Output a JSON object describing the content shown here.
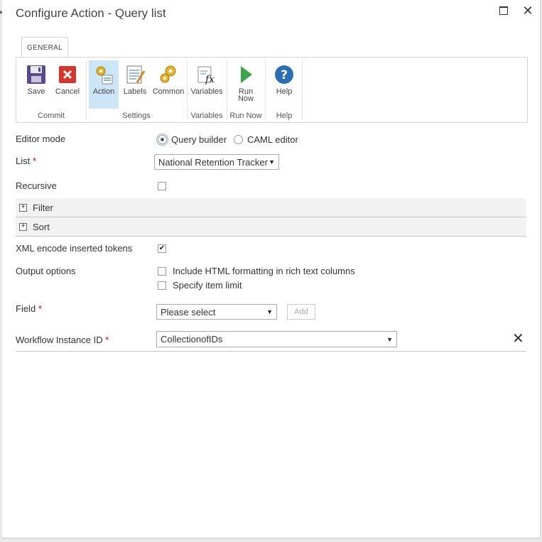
{
  "dialog": {
    "title": "Configure Action - Query list",
    "maximize_icon": "maximize-icon",
    "close_glyph": "✕"
  },
  "ribbon": {
    "tab": "GENERAL",
    "buttons": {
      "save": "Save",
      "cancel": "Cancel",
      "action": "Action",
      "labels": "Labels",
      "common": "Common",
      "variables": "Variables",
      "run_now_1": "Run",
      "run_now_2": "Now",
      "help": "Help"
    },
    "groups": {
      "commit": "Commit",
      "settings": "Settings",
      "variables": "Variables",
      "run_now": "Run Now",
      "help": "Help"
    }
  },
  "form": {
    "editor_mode": {
      "label": "Editor mode",
      "opt1": "Query builder",
      "opt2": "CAML editor",
      "selected": "Query builder"
    },
    "list": {
      "label": "List",
      "req": "*",
      "value": "National Retention Tracker"
    },
    "recursive": {
      "label": "Recursive",
      "checked": false
    },
    "filter": {
      "label": "Filter",
      "expander": "+"
    },
    "sort": {
      "label": "Sort",
      "expander": "+"
    },
    "xml_encode": {
      "label": "XML encode inserted tokens",
      "checked": true,
      "check_glyph": "✔"
    },
    "output_options": {
      "label": "Output options",
      "opt1": "Include HTML formatting in rich text columns",
      "opt2": "Specify item limit"
    },
    "field": {
      "label": "Field",
      "req": "*",
      "value": "Please select",
      "add_button": "Add"
    },
    "workflow_instance_id": {
      "label": "Workflow Instance ID",
      "req": "*",
      "value": "CollectionofIDs",
      "remove_glyph": "✕"
    }
  },
  "colors": {
    "active_button_bg": "#cde6f7",
    "required": "#cc0000",
    "help_icon": "#2a6fb3",
    "run_icon": "#3aa64a",
    "cancel_icon": "#d9342b"
  }
}
